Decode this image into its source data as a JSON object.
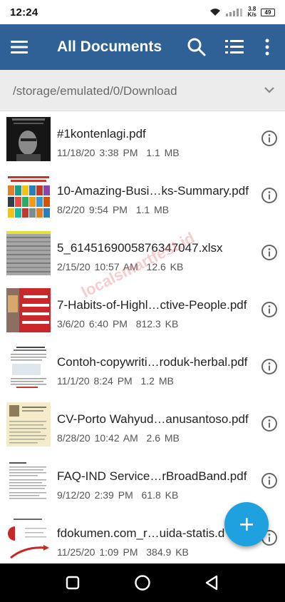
{
  "status_bar": {
    "time": "12:24",
    "speed_value": "3.8",
    "speed_unit": "K/s",
    "battery": "49"
  },
  "app_bar": {
    "title": "All Documents",
    "icons": [
      "menu-icon",
      "search-icon",
      "list-view-icon",
      "more-vert-icon"
    ],
    "color": "#2f6197"
  },
  "path_bar": {
    "path": "/storage/emulated/0/Download"
  },
  "files": [
    {
      "name": "#1kontenlagi.pdf",
      "date": "11/18/20 3:38 PM",
      "size": "1.1 MB"
    },
    {
      "name": "10-Amazing-Busi…ks-Summary.pdf",
      "date": "8/2/20 9:54 PM",
      "size": "1.1 MB"
    },
    {
      "name": "5_6145169005876347047.xlsx",
      "date": "2/15/20 10:57 AM",
      "size": "12.6 KB"
    },
    {
      "name": "7-Habits-of-Highl…ctive-People.pdf",
      "date": "3/6/20 6:40 PM",
      "size": "812.3 KB"
    },
    {
      "name": "Contoh-copywriti…roduk-herbal.pdf",
      "date": "11/1/20 8:24 PM",
      "size": "1.2 MB"
    },
    {
      "name": "CV-Porto Wahyud…anusantoso.pdf",
      "date": "8/28/20 10:42 AM",
      "size": "2.6 MB"
    },
    {
      "name": "FAQ-IND Service…rBroadBand.pdf",
      "date": "9/12/20 2:39 PM",
      "size": "61.8 KB"
    },
    {
      "name": "fdokumen.com_r…uida-statis.d",
      "date": "11/25/20 1:09 PM",
      "size": "384.9 KB"
    }
  ],
  "watermark": "localsmartfest.id",
  "fab": {
    "icon": "plus-icon",
    "color": "#1fa1e0"
  }
}
